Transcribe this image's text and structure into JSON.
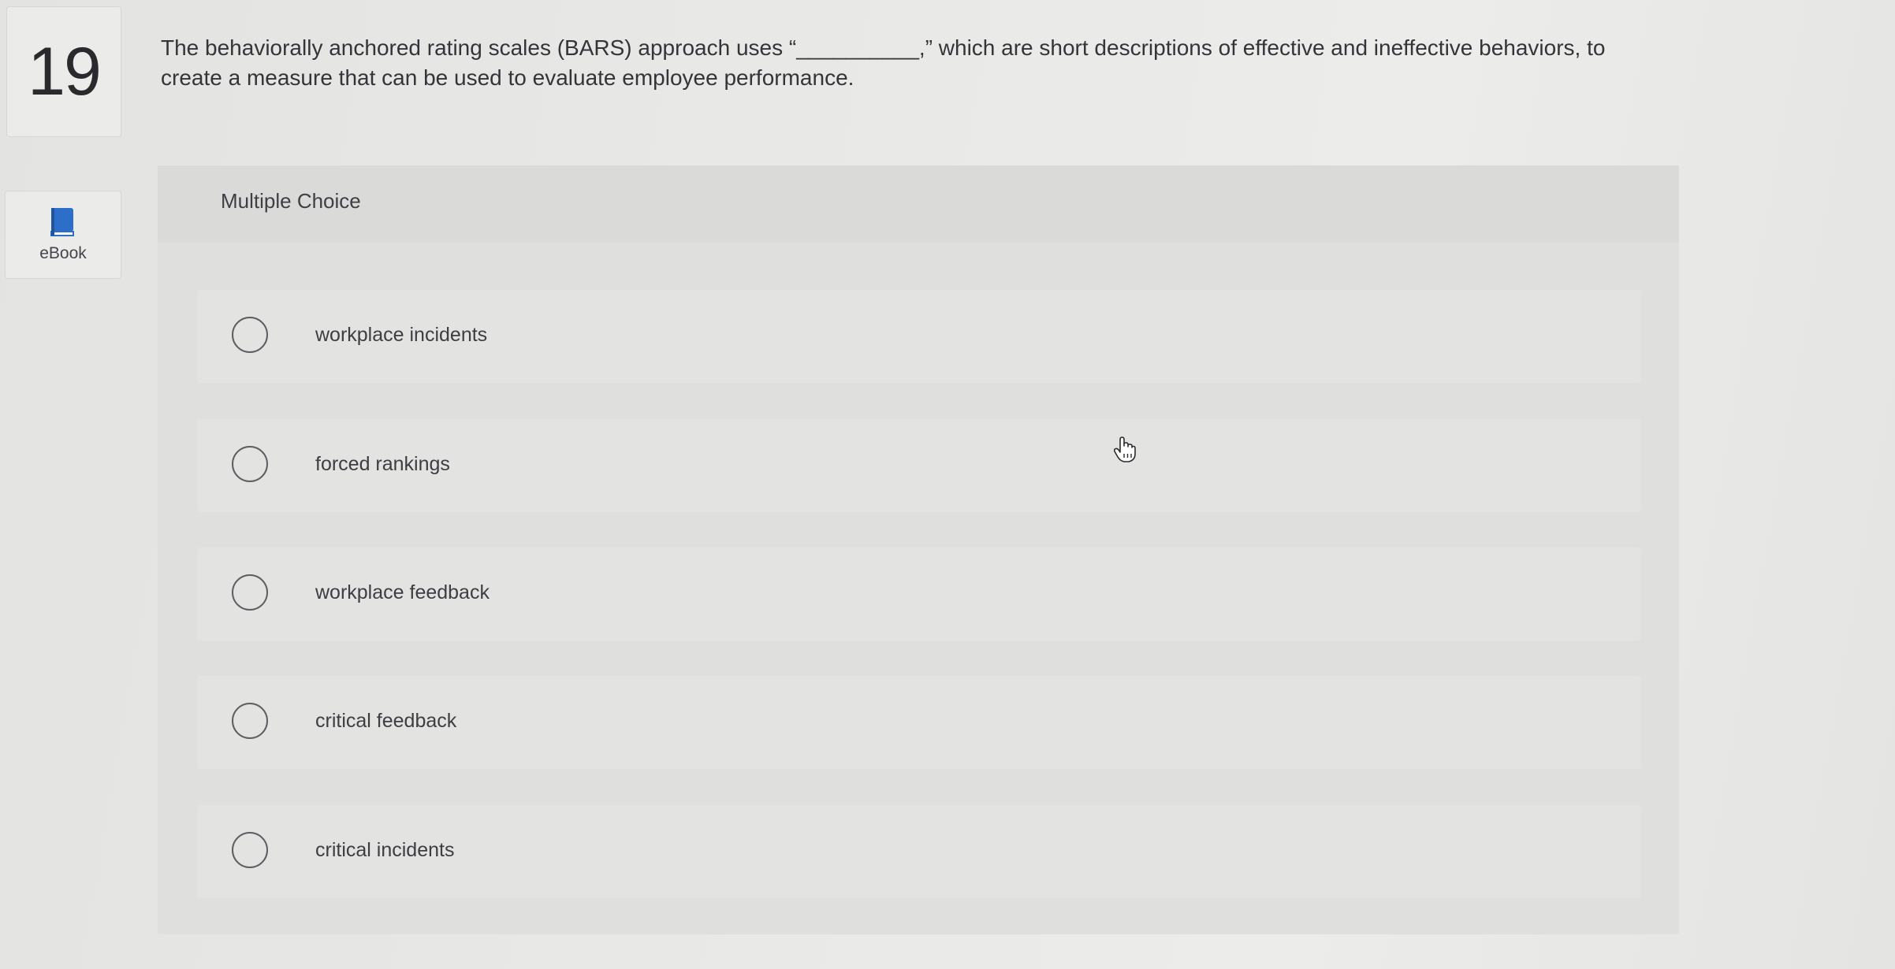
{
  "question": {
    "number": "19",
    "text": "The behaviorally anchored rating scales (BARS) approach uses “__________,” which are short descriptions of effective and ineffective behaviors, to create a measure that can be used to evaluate employee performance."
  },
  "sidebar": {
    "ebook_label": "eBook",
    "ebook_icon": "book-icon",
    "accent_color": "#2d6fc8"
  },
  "panel": {
    "title": "Multiple Choice",
    "options": [
      {
        "label": "workplace incidents",
        "selected": false
      },
      {
        "label": "forced rankings",
        "selected": false
      },
      {
        "label": "workplace feedback",
        "selected": false
      },
      {
        "label": "critical feedback",
        "selected": false
      },
      {
        "label": "critical incidents",
        "selected": false
      }
    ]
  }
}
